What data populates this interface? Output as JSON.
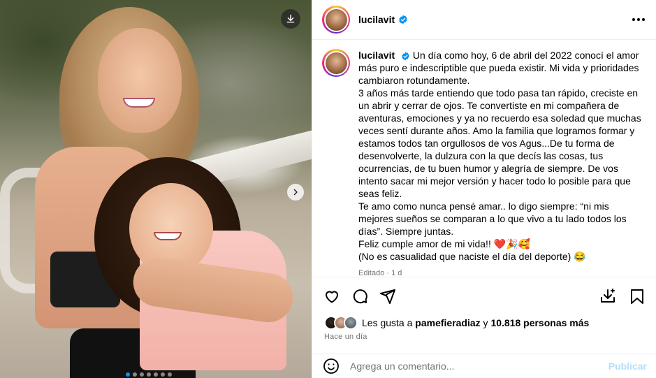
{
  "post": {
    "username": "lucilavit",
    "verified": true,
    "icons": {
      "download": "download-icon",
      "next": "chevron-right-icon",
      "more": "more-options-icon"
    }
  },
  "caption": {
    "username": "lucilavit",
    "paragraphs": [
      "Un día como hoy, 6 de abril del 2022 conocí el amor más puro e indescriptible que pueda existir. Mi vida y prioridades cambiaron rotundamente.",
      "3 años más tarde entiendo que todo pasa tan rápido, creciste en un abrir y cerrar de ojos. Te convertiste en mi compañera de aventuras, emociones y ya no recuerdo esa soledad que muchas veces sentí durante años. Amo la familia que logramos formar y estamos todos tan orgullosos de vos Agus...De tu forma de desenvolverte, la dulzura con la que decís las cosas, tus ocurrencias, de tu buen humor y alegría de siempre. De vos intento sacar mi mejor versión y hacer todo lo posible para que seas feliz.",
      "Te amo como nunca pensé amar.. lo digo siempre: “ni mis mejores sueños se comparan a lo que vivo a tu lado todos los días”. Siempre juntas.",
      "Feliz cumple amor de mi vida!! ❤️🎉🥰",
      "(No es casualidad que naciste el día del deporte) 😂"
    ],
    "edited": "Editado · 1 d"
  },
  "actions": {
    "like": "heart-icon",
    "comment": "comment-icon",
    "share": "share-icon",
    "save_collection": "save-to-collection-icon",
    "bookmark": "bookmark-icon"
  },
  "likes": {
    "prefix": "Les gusta a",
    "user": "pamefieradiaz",
    "connector": "y",
    "count": "10.818 personas más"
  },
  "time": "Hace un día",
  "comment": {
    "placeholder": "Agrega un comentario...",
    "publish": "Publicar"
  },
  "carousel": {
    "total": 7,
    "active_index": 0,
    "active_color": "#0095f6"
  },
  "colors": {
    "verified": "#0095f6",
    "publish_disabled": "#b2dffc",
    "heart": "#ed4956"
  }
}
